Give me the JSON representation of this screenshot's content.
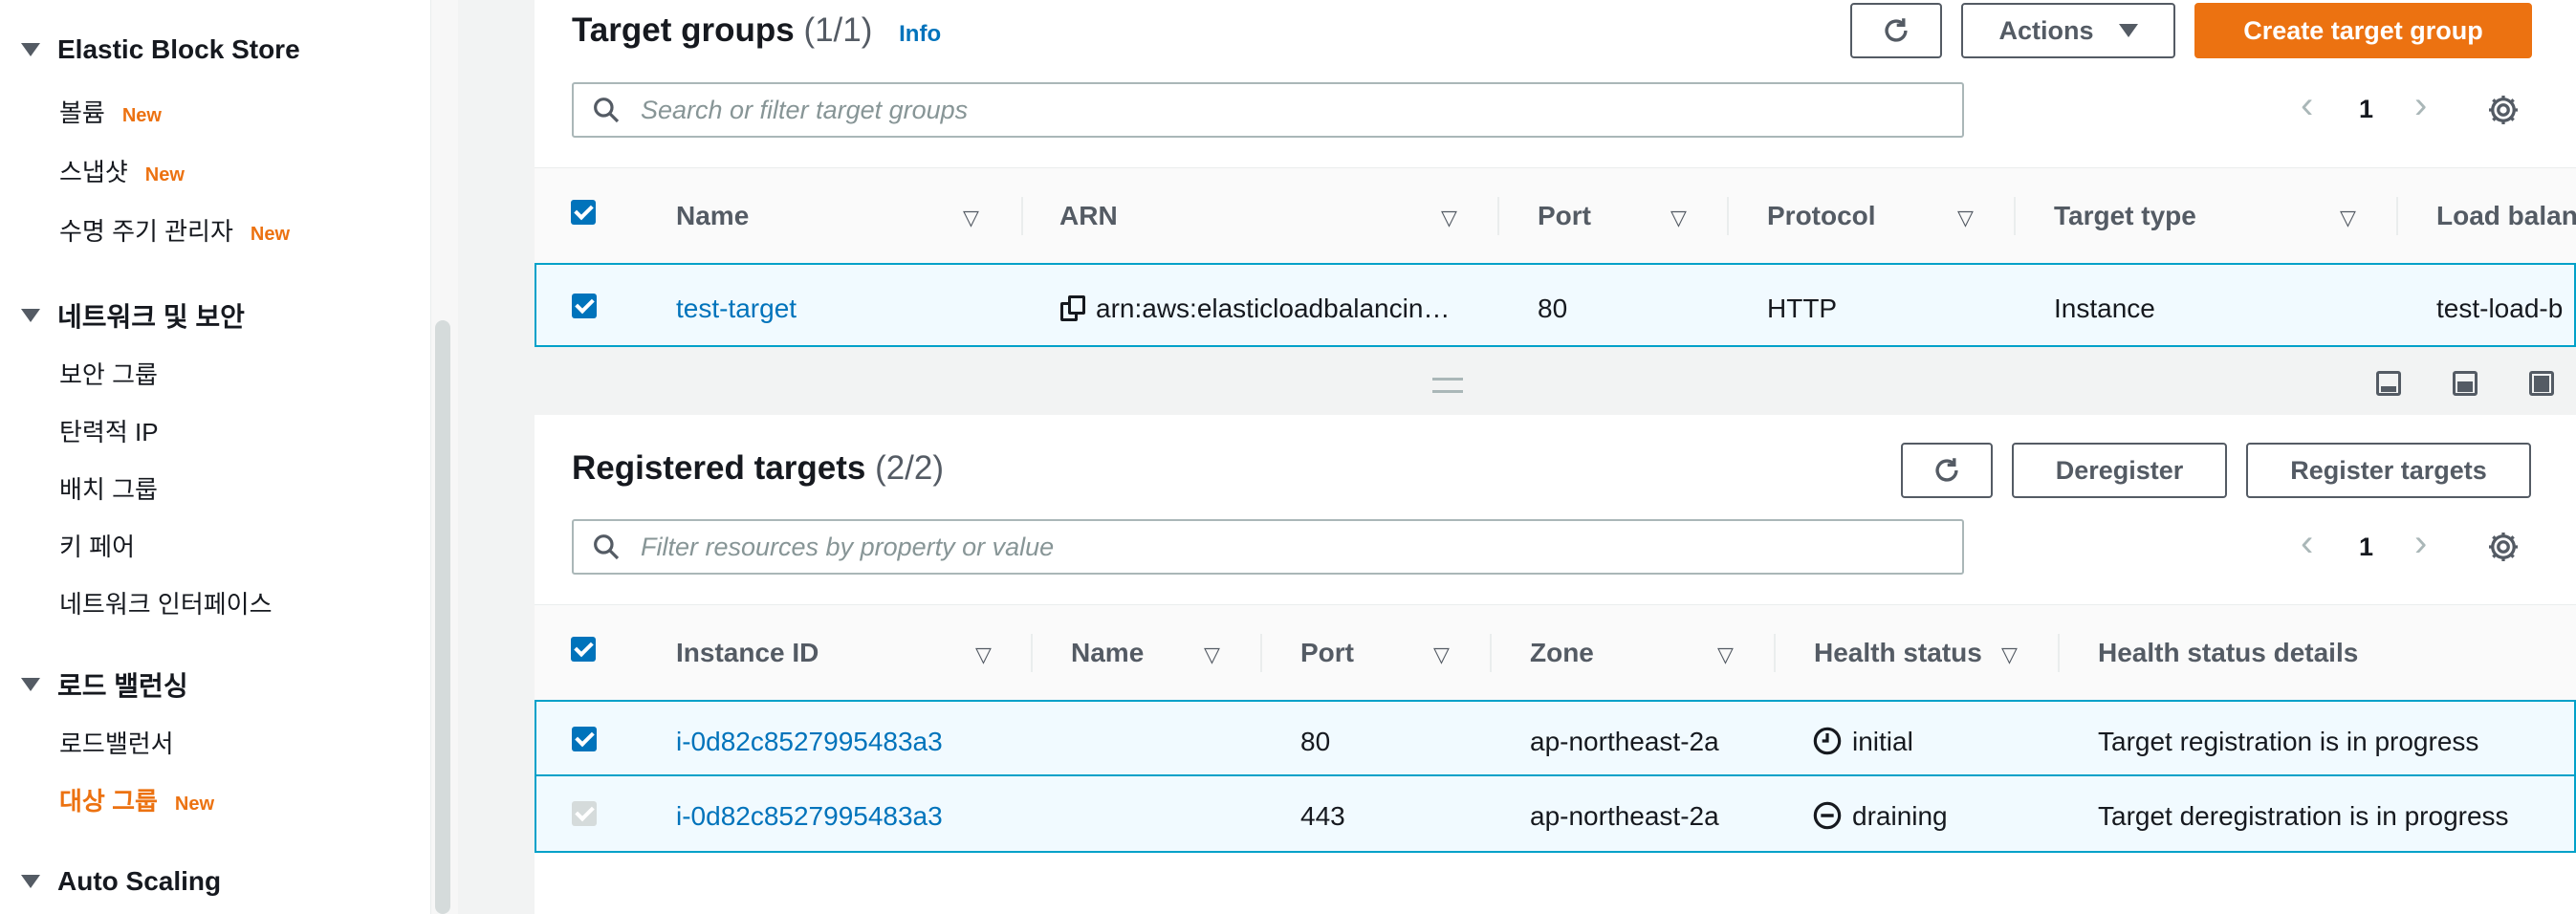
{
  "sidebar": {
    "sections": [
      {
        "title": "Elastic Block Store",
        "items": [
          {
            "label": "볼륨",
            "badge": "New"
          },
          {
            "label": "스냅샷",
            "badge": "New"
          },
          {
            "label": "수명 주기 관리자",
            "badge": "New"
          }
        ]
      },
      {
        "title": "네트워크 및 보안",
        "items": [
          {
            "label": "보안 그룹"
          },
          {
            "label": "탄력적 IP"
          },
          {
            "label": "배치 그룹"
          },
          {
            "label": "키 페어"
          },
          {
            "label": "네트워크 인터페이스"
          }
        ]
      },
      {
        "title": "로드 밸런싱",
        "items": [
          {
            "label": "로드밸런서"
          },
          {
            "label": "대상 그룹",
            "badge": "New",
            "active": true
          }
        ]
      },
      {
        "title": "Auto Scaling",
        "items": []
      }
    ]
  },
  "target_groups": {
    "title": "Target groups",
    "count": "(1/1)",
    "info": "Info",
    "refresh_icon": "refresh-icon",
    "actions_label": "Actions",
    "create_label": "Create target group",
    "search_placeholder": "Search or filter target groups",
    "page": "1",
    "columns": [
      "Name",
      "ARN",
      "Port",
      "Protocol",
      "Target type",
      "Load balan"
    ],
    "rows": [
      {
        "name": "test-target",
        "arn": "arn:aws:elasticloadbalancin…",
        "port": "80",
        "protocol": "HTTP",
        "target_type": "Instance",
        "load_balancer": "test-load-b"
      }
    ]
  },
  "registered_targets": {
    "title": "Registered targets",
    "count": "(2/2)",
    "deregister_label": "Deregister",
    "register_label": "Register targets",
    "search_placeholder": "Filter resources by property or value",
    "page": "1",
    "columns": [
      "Instance ID",
      "Name",
      "Port",
      "Zone",
      "Health status",
      "Health status details"
    ],
    "rows": [
      {
        "instance_id": "i-0d82c8527995483a3",
        "name": "",
        "port": "80",
        "zone": "ap-northeast-2a",
        "health": "initial",
        "details": "Target registration is in progress"
      },
      {
        "instance_id": "i-0d82c8527995483a3",
        "name": "",
        "port": "443",
        "zone": "ap-northeast-2a",
        "health": "draining",
        "details": "Target deregistration is in progress"
      }
    ]
  },
  "colors": {
    "accent": "#ec7211",
    "link": "#0073bb",
    "selected_row": "#f1faff"
  }
}
